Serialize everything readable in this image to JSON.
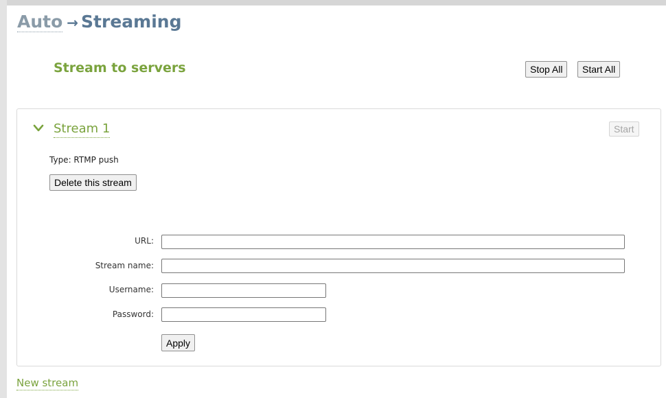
{
  "breadcrumb": {
    "parent": "Auto",
    "arrow": "→",
    "current": "Streaming"
  },
  "section": {
    "title": "Stream to servers",
    "stop_all_label": "Stop All",
    "start_all_label": "Start All"
  },
  "stream": {
    "title": "Stream 1",
    "start_label": "Start",
    "type_text": "Type: RTMP push",
    "delete_label": "Delete this stream",
    "fields": {
      "url_label": "URL:",
      "url_value": "",
      "name_label": "Stream name:",
      "name_value": "",
      "username_label": "Username:",
      "username_value": "",
      "password_label": "Password:",
      "password_value": ""
    },
    "apply_label": "Apply"
  },
  "new_stream_label": "New stream",
  "colors": {
    "accent_green": "#7aa33d",
    "breadcrumb_blue": "#5a7894",
    "breadcrumb_gray": "#8a9ba8"
  },
  "icons": {
    "expand": "chevron-down-icon"
  }
}
